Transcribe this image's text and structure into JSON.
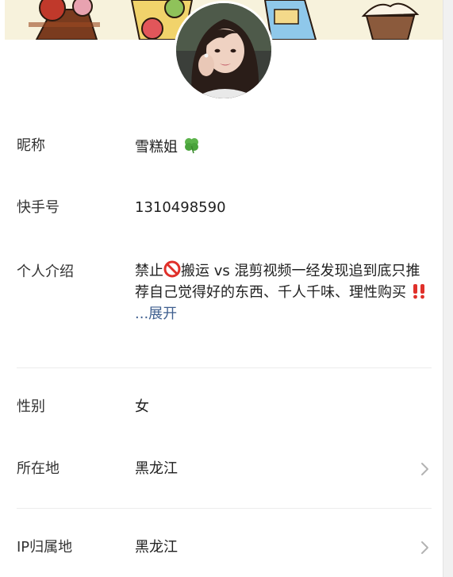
{
  "profile": {
    "nickname_label": "昵称",
    "nickname_value": "雪糕姐",
    "id_label": "快手号",
    "id_value": "1310498590",
    "bio_label": "个人介绍",
    "bio_part1": "禁止",
    "bio_part2": "搬运 vs 混剪视频一经发现追到底只推荐自己觉得好的东西、千人千味、理性购买",
    "bio_expand": "...展开",
    "gender_label": "性别",
    "gender_value": "女",
    "location_label": "所在地",
    "location_value": "黑龙江",
    "ip_label": "IP归属地",
    "ip_value": "黑龙江"
  },
  "icons": {
    "nickname_badge": "four-leaf-clover-icon",
    "bio_prohibit": "prohibited-icon",
    "bio_exclaim": "double-exclamation-icon",
    "row_arrow": "chevron-right-icon"
  },
  "colors": {
    "expand_link": "#3f5f8f",
    "divider": "#ececec",
    "banner_bg": "#f7f2dc"
  }
}
